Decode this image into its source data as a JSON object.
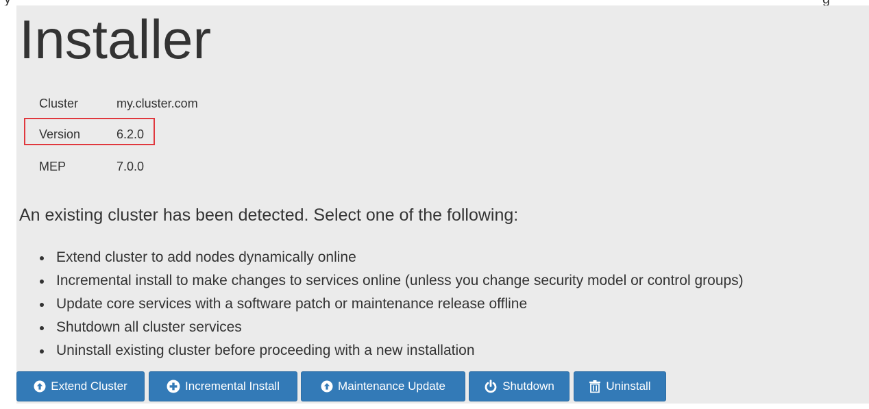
{
  "title": "Installer",
  "info": {
    "cluster": {
      "label": "Cluster",
      "value": "my.cluster.com"
    },
    "version": {
      "label": "Version",
      "value": "6.2.0"
    },
    "mep": {
      "label": "MEP",
      "value": "7.0.0"
    }
  },
  "intro": "An existing cluster has been detected. Select one of the following:",
  "options": [
    "Extend cluster to add nodes dynamically online",
    "Incremental install to make changes to services online (unless you change security model or control groups)",
    "Update core services with a software patch or maintenance release offline",
    "Shutdown all cluster services",
    "Uninstall existing cluster before proceeding with a new installation"
  ],
  "buttons": [
    {
      "label": "Extend Cluster",
      "icon": "circle-arrow-up-icon"
    },
    {
      "label": "Incremental Install",
      "icon": "plus-circle-icon"
    },
    {
      "label": "Maintenance Update",
      "icon": "circle-arrow-up-icon"
    },
    {
      "label": "Shutdown",
      "icon": "power-icon"
    },
    {
      "label": "Uninstall",
      "icon": "trash-icon"
    }
  ],
  "colors": {
    "background": "#ebebeb",
    "text": "#333333",
    "button": "#337ab7",
    "button_border": "#2e6da4",
    "highlight": "#e0383e"
  }
}
